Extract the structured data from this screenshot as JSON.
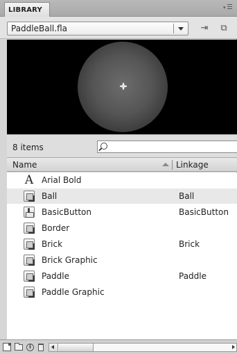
{
  "panel": {
    "tab_label": "LIBRARY",
    "menu_icon": "panel-menu-icon"
  },
  "document": {
    "selected": "PaddleBall.fla",
    "pin_icon": "pin-icon",
    "new_library_icon": "new-library-panel-icon"
  },
  "preview": {
    "symbol": "ball"
  },
  "count": {
    "label": "8 items"
  },
  "search": {
    "placeholder": "",
    "value": ""
  },
  "columns": {
    "name": "Name",
    "linkage": "Linkage"
  },
  "items": [
    {
      "name": "Arial Bold",
      "linkage": "",
      "icon": "font-icon"
    },
    {
      "name": "Ball",
      "linkage": "Ball",
      "icon": "movieclip-icon",
      "selected": true
    },
    {
      "name": "BasicButton",
      "linkage": "BasicButton",
      "icon": "button-icon"
    },
    {
      "name": "Border",
      "linkage": "",
      "icon": "movieclip-icon"
    },
    {
      "name": "Brick",
      "linkage": "Brick",
      "icon": "movieclip-icon"
    },
    {
      "name": "Brick Graphic",
      "linkage": "",
      "icon": "movieclip-icon"
    },
    {
      "name": "Paddle",
      "linkage": "Paddle",
      "icon": "movieclip-icon"
    },
    {
      "name": "Paddle Graphic",
      "linkage": "",
      "icon": "movieclip-icon"
    }
  ],
  "toolbar": {
    "icons": [
      "new-symbol-icon",
      "new-folder-icon",
      "properties-icon",
      "delete-icon"
    ]
  }
}
